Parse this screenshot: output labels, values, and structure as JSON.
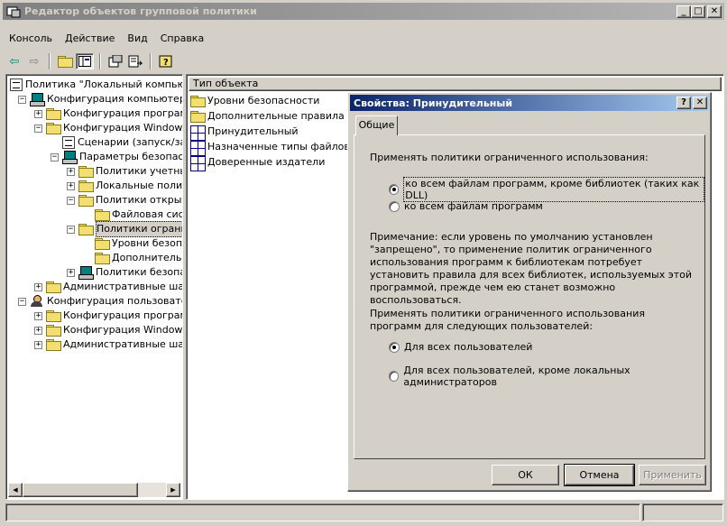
{
  "window": {
    "title": "Редактор объектов групповой политики"
  },
  "menu": [
    "Консоль",
    "Действие",
    "Вид",
    "Справка"
  ],
  "tree": [
    {
      "label": "Политика \"Локальный компьюте",
      "icon": "policy-doc-icon",
      "level": 0,
      "pm": ""
    },
    {
      "label": "Конфигурация компьютера",
      "icon": "computer-icon",
      "level": 1,
      "pm": "−"
    },
    {
      "label": "Конфигурация программ",
      "icon": "folder-icon",
      "level": 2,
      "pm": "+"
    },
    {
      "label": "Конфигурация Windows",
      "icon": "folder-icon",
      "level": 2,
      "pm": "−"
    },
    {
      "label": "Сценарии (запуск/зав",
      "icon": "script-icon",
      "level": 3,
      "pm": ""
    },
    {
      "label": "Параметры безопасно",
      "icon": "security-icon",
      "level": 3,
      "pm": "−"
    },
    {
      "label": "Политики учетны",
      "icon": "folder-icon",
      "level": 4,
      "pm": "+"
    },
    {
      "label": "Локальные полит",
      "icon": "folder-icon",
      "level": 4,
      "pm": "+"
    },
    {
      "label": "Политики открыт",
      "icon": "folder-icon",
      "level": 4,
      "pm": "−"
    },
    {
      "label": "Файловая сист",
      "icon": "folder-icon",
      "level": 5,
      "pm": ""
    },
    {
      "label": "Политики огранич",
      "icon": "folder-open-icon",
      "level": 4,
      "pm": "−"
    },
    {
      "label": "Уровни безопа",
      "icon": "folder-icon",
      "level": 5,
      "pm": ""
    },
    {
      "label": "Дополнительн",
      "icon": "folder-icon",
      "level": 5,
      "pm": ""
    },
    {
      "label": "Политики безопас",
      "icon": "security-icon",
      "level": 4,
      "pm": "+"
    },
    {
      "label": "Административные шабл",
      "icon": "folder-icon",
      "level": 2,
      "pm": "+"
    },
    {
      "label": "Конфигурация пользователя",
      "icon": "user-icon",
      "level": 1,
      "pm": "−"
    },
    {
      "label": "Конфигурация программ",
      "icon": "folder-icon",
      "level": 2,
      "pm": "+"
    },
    {
      "label": "Конфигурация Windows",
      "icon": "folder-icon",
      "level": 2,
      "pm": "+"
    },
    {
      "label": "Административные шабл",
      "icon": "folder-icon",
      "level": 2,
      "pm": "+"
    }
  ],
  "list": {
    "header": "Тип объекта",
    "items": [
      {
        "label": "Уровни безопасности",
        "icon": "folder-icon"
      },
      {
        "label": "Дополнительные правила",
        "icon": "folder-icon"
      },
      {
        "label": "Принудительный",
        "icon": "policy-icon"
      },
      {
        "label": "Назначенные типы файлов",
        "icon": "policy-icon"
      },
      {
        "label": "Доверенные издатели",
        "icon": "policy-icon"
      }
    ]
  },
  "dialog": {
    "title": "Свойства: Принудительный",
    "help_btn": "?",
    "close_btn": "✕",
    "tab": "Общие",
    "group1_label": "Применять политики ограниченного использования:",
    "radio1": "ко всем файлам программ, кроме библиотек (таких как DLL)",
    "radio2": "ко всем файлам программ",
    "note": "Примечание: если уровень по умолчанию установлен \"запрещено\", то применение политик ограниченного использования программ к библиотекам потребует установить правила для всех библиотек, используемых этой программой, прежде чем ею станет возможно воспользоваться.",
    "group2_label": "Применять политики ограниченного использования программ для следующих пользователей:",
    "radio3": "Для всех пользователей",
    "radio4": "Для всех пользователей, кроме локальных администраторов",
    "ok": "ОК",
    "cancel": "Отмена",
    "apply": "Применить"
  }
}
